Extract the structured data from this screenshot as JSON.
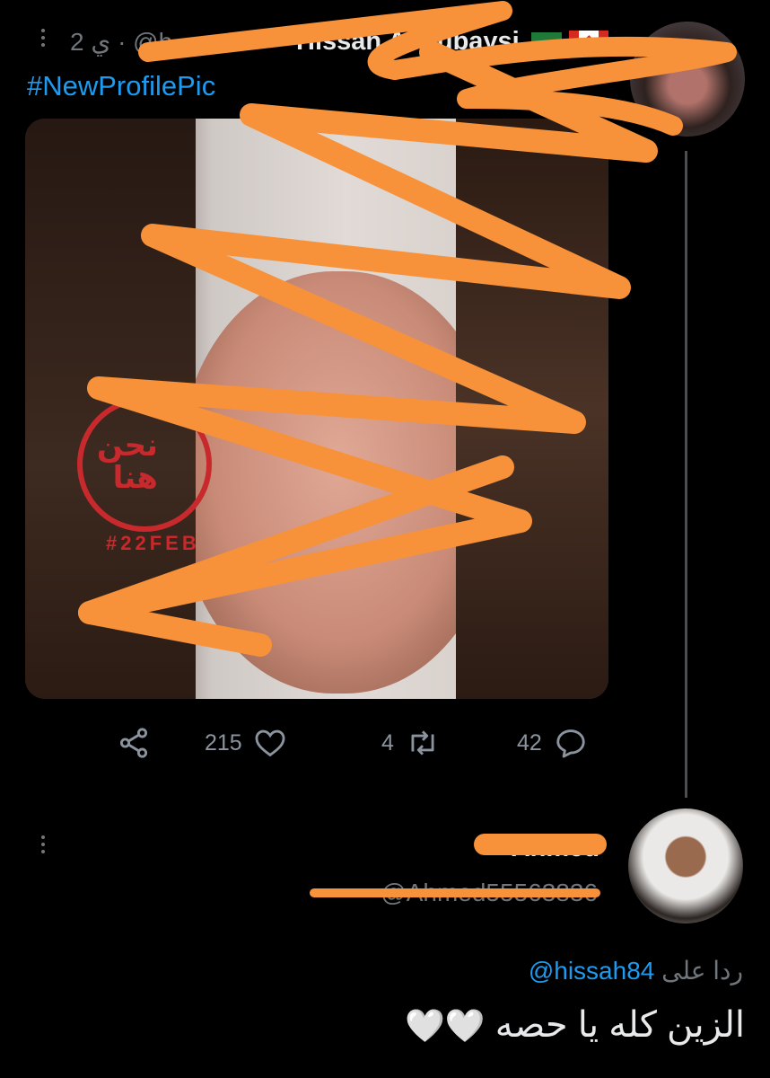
{
  "tweet": {
    "time": "2 ي",
    "separator": "·",
    "handle_fragment": "@h",
    "author_name": "Hissah Al qubaysi",
    "hashtag": "#NewProfilePic",
    "image_watermark": "#22FEB",
    "image_arabic_text": [
      "نحن",
      "هنا"
    ],
    "actions": {
      "likes": "215",
      "retweets": "4",
      "replies": "42"
    }
  },
  "reply": {
    "author_name_fragment": "Ahmed",
    "handle_fragment": "@Ahmed55563836",
    "replying_to_label": "ردا على",
    "replying_to_handle": "@hissah84",
    "text": "الزين كله يا حصه",
    "emoji": "🤍🤍"
  },
  "colors": {
    "background": "#000000",
    "link": "#1d9bf0",
    "muted": "#71767b",
    "scribble": "#f7923a"
  },
  "icons": [
    "more-dots-icon",
    "share-icon",
    "heart-icon",
    "retweet-icon",
    "reply-icon"
  ]
}
